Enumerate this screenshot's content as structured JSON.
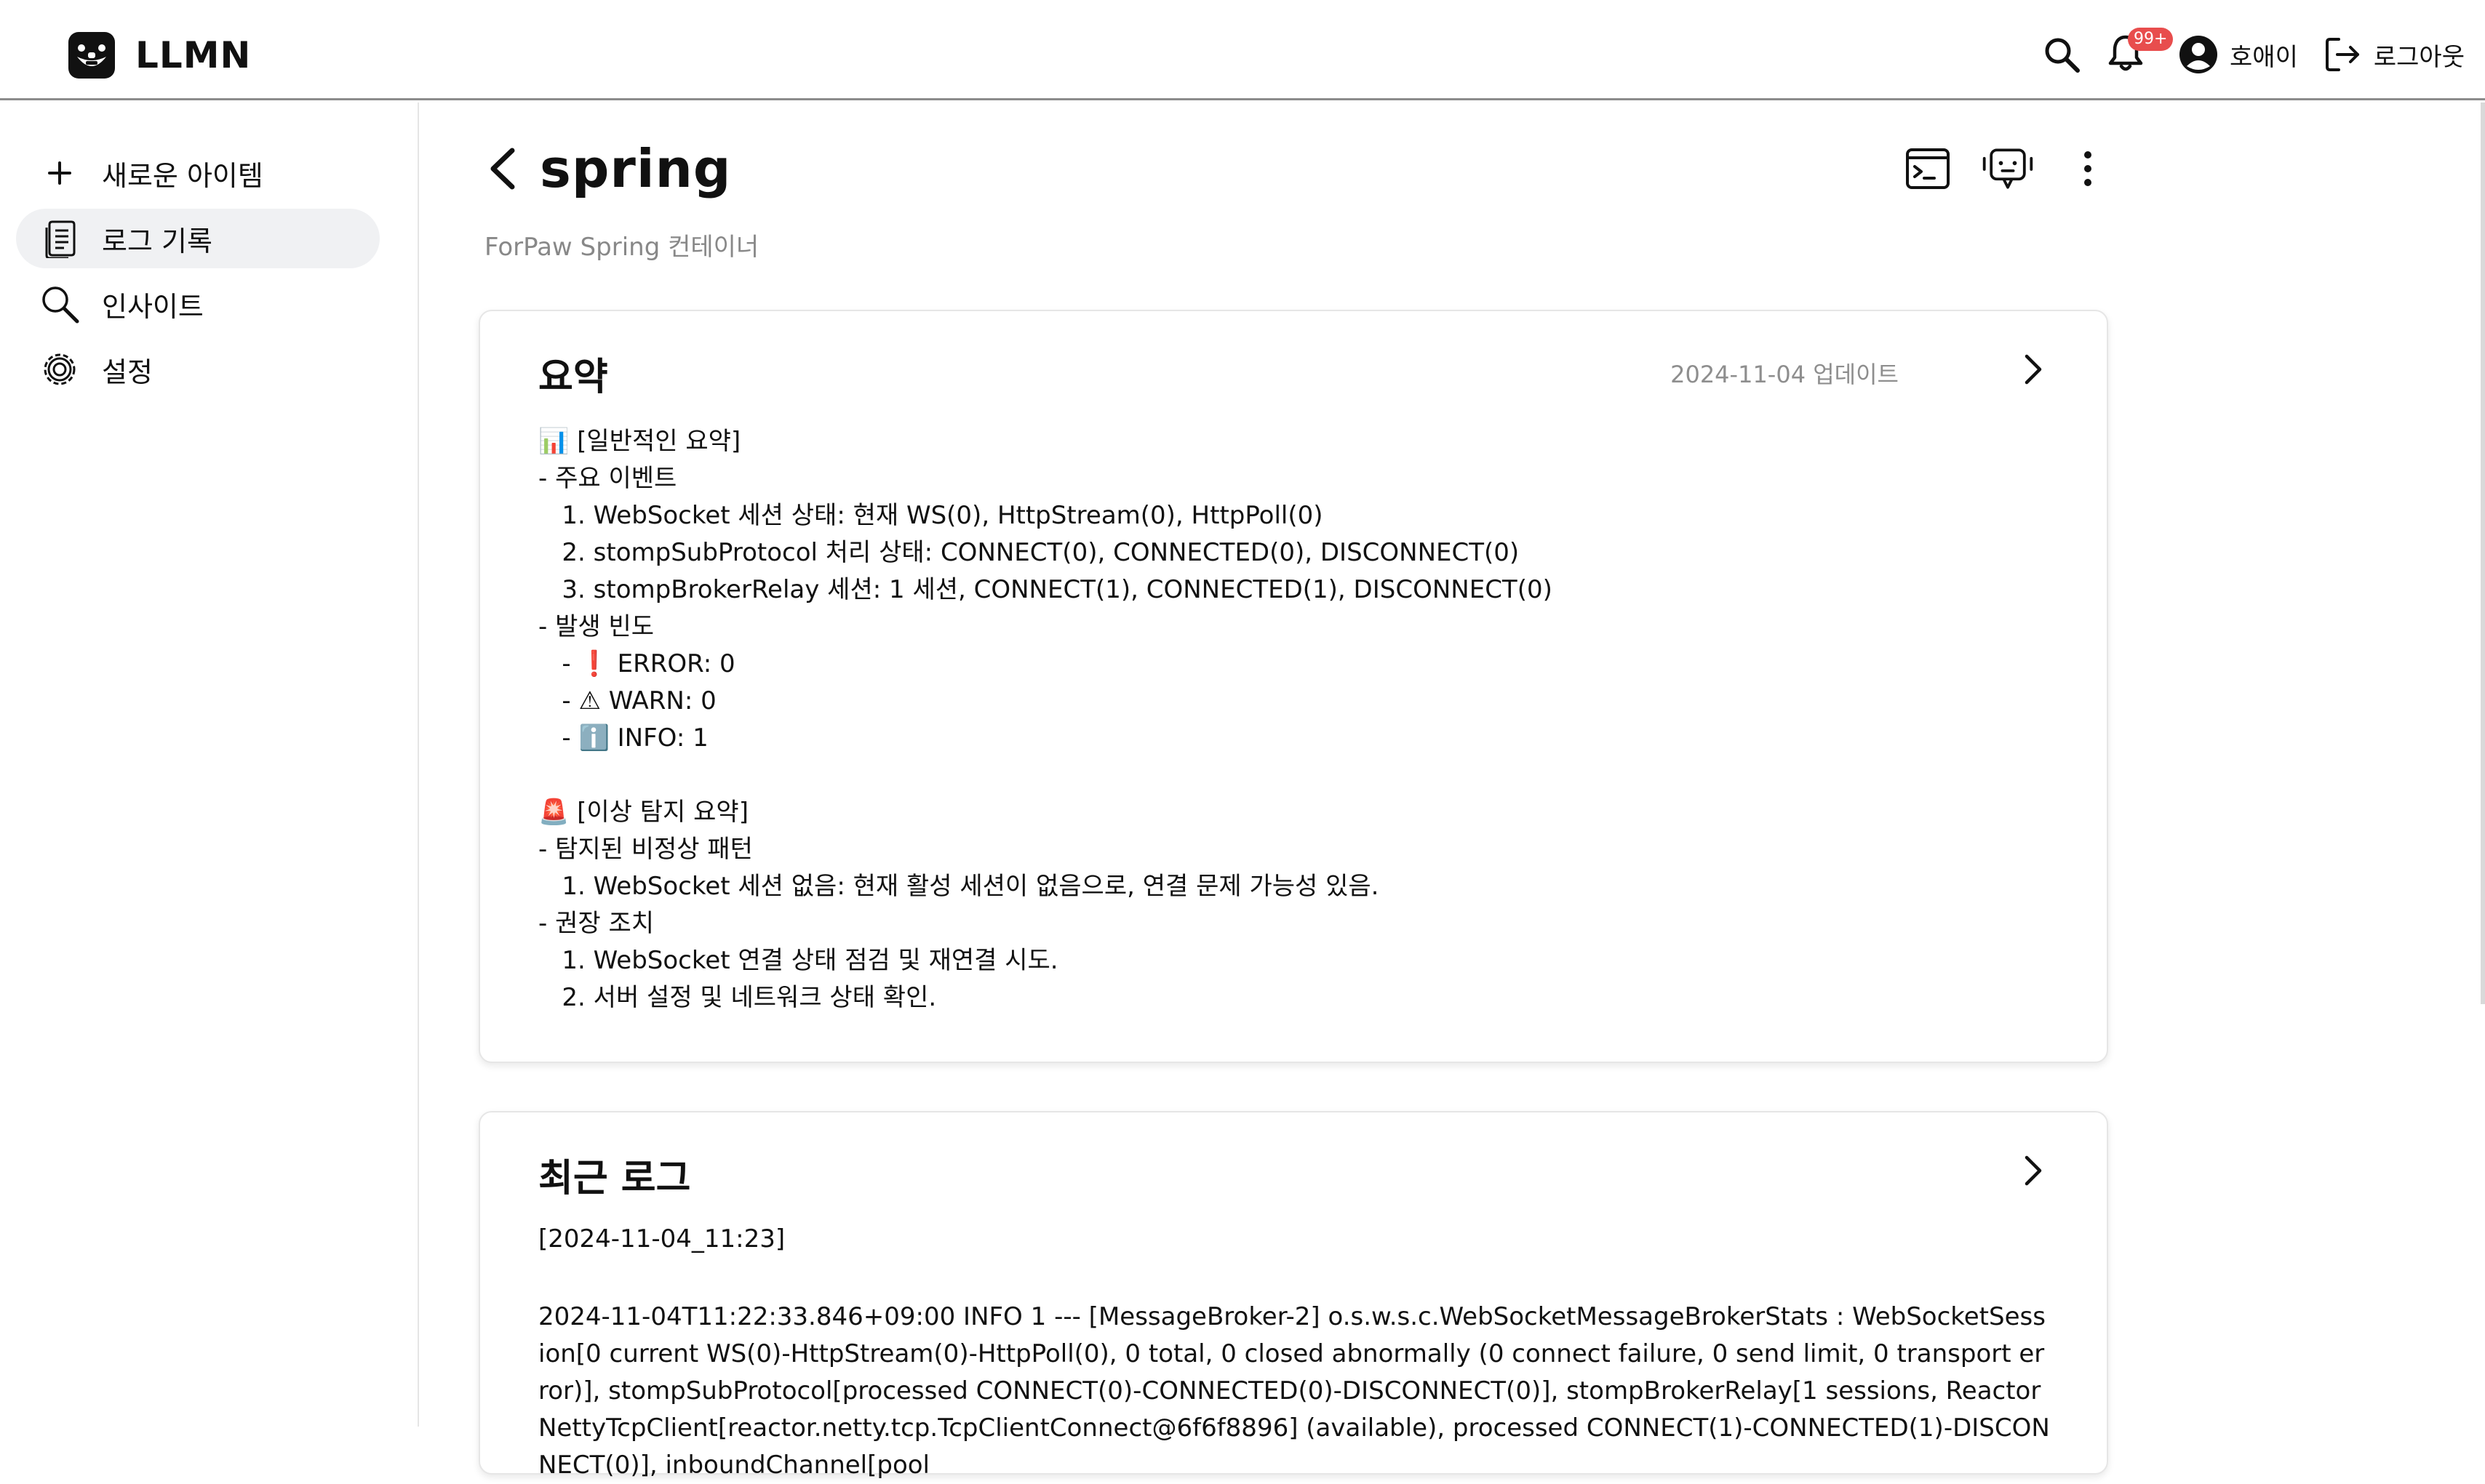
{
  "header": {
    "brand_name": "LLMN",
    "notification_badge": "99+",
    "user_name": "호애이",
    "logout_label": "로그아웃"
  },
  "sidebar": {
    "items": [
      {
        "label": "새로운 아이템",
        "icon": "plus-icon"
      },
      {
        "label": "로그 기록",
        "icon": "document-icon",
        "active": true
      },
      {
        "label": "인사이트",
        "icon": "search-icon"
      },
      {
        "label": "설정",
        "icon": "gear-icon"
      }
    ]
  },
  "page": {
    "title": "spring",
    "subtitle": "ForPaw Spring 컨테이너"
  },
  "summary_card": {
    "title": "요약",
    "updated": "2024-11-04 업데이트",
    "body": "📊 [일반적인 요약]\n- 주요 이벤트\n   1. WebSocket 세션 상태: 현재 WS(0), HttpStream(0), HttpPoll(0)\n   2. stompSubProtocol 처리 상태: CONNECT(0), CONNECTED(0), DISCONNECT(0)\n   3. stompBrokerRelay 세션: 1 세션, CONNECT(1), CONNECTED(1), DISCONNECT(0)\n- 발생 빈도\n   - ❗ ERROR: 0\n   - ⚠ WARN: 0\n   - ℹ️ INFO: 1\n\n🚨 [이상 탐지 요약]\n- 탐지된 비정상 패턴\n   1. WebSocket 세션 없음: 현재 활성 세션이 없음으로, 연결 문제 가능성 있음.\n- 권장 조치\n   1. WebSocket 연결 상태 점검 및 재연결 시도.\n   2. 서버 설정 및 네트워크 상태 확인."
  },
  "logs_card": {
    "title": "최근 로그",
    "timestamp": "[2024-11-04_11:23]",
    "entry": "2024-11-04T11:22:33.846+09:00  INFO 1 --- [MessageBroker-2] o.s.w.s.c.WebSocketMessageBrokerStats    : WebSocketSession[0 current WS(0)-HttpStream(0)-HttpPoll(0), 0 total, 0 closed abnormally (0 connect failure, 0 send limit, 0 transport error)], stompSubProtocol[processed CONNECT(0)-CONNECTED(0)-DISCONNECT(0)], stompBrokerRelay[1 sessions, ReactorNettyTcpClient[reactor.netty.tcp.TcpClientConnect@6f6f8896] (available), processed CONNECT(1)-CONNECTED(1)-DISCONNECT(0)], inboundChannel[pool"
  },
  "colors": {
    "badge": "#e84d4d",
    "active_bg": "#f0f1f3",
    "muted_text": "#888888",
    "header_border": "#8c8c8c"
  }
}
